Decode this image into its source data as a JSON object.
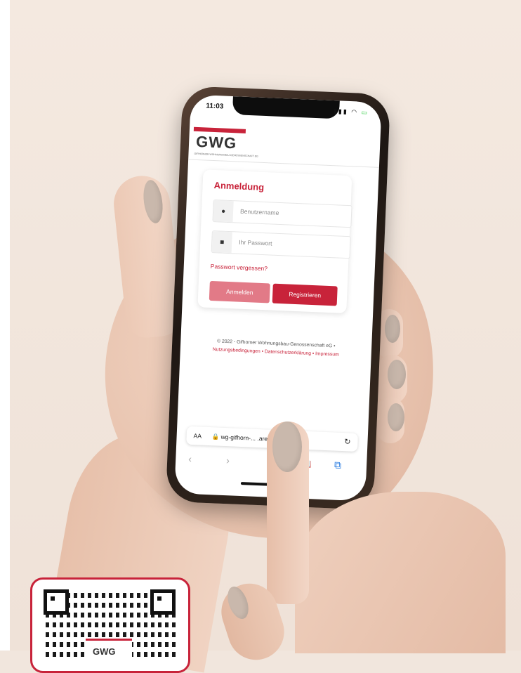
{
  "status_bar": {
    "time": "11:03",
    "icons": "📶 📶 🔋"
  },
  "brand": {
    "logo": "GWG",
    "tagline": "GIFHORNER WOHNUNGSBAU-GENOSSENSCHAFT EG"
  },
  "login": {
    "title": "Anmeldung",
    "username_placeholder": "Benutzername",
    "password_placeholder": "Ihr Passwort",
    "forgot_link": "Passwort vergessen?",
    "login_button": "Anmelden",
    "register_button": "Registrieren"
  },
  "footer": {
    "copyright": "© 2022 - Gifhorner Wohnungsbau-Genossenschaft eG •",
    "links": "Nutzungsbedingungen • Datenschutzerklärung • Impressum"
  },
  "browser": {
    "aa": "AA",
    "url": "🔒 wg-gifhorn-... .areon.com",
    "reload": "↻",
    "back": "‹",
    "forward": "›",
    "bookmarks": "📖",
    "tabs": "⧉"
  },
  "qr_badge": {
    "logo": "GWG"
  },
  "colors": {
    "brand_red": "#c8233a",
    "light_red": "#e27a87"
  }
}
